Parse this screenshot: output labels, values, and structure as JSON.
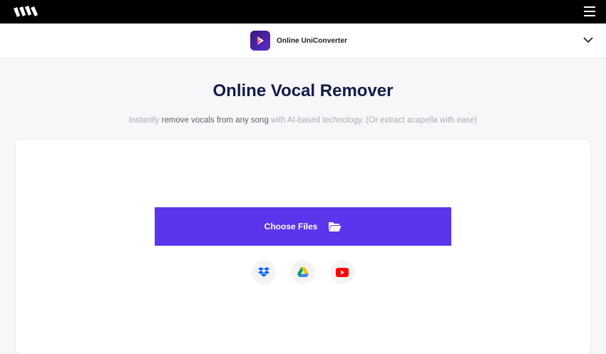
{
  "topbar": {
    "logo_icon": "wondershare-logo-icon",
    "menu_icon": "hamburger-menu-icon"
  },
  "subnav": {
    "product_name": "Online UniConverter",
    "product_icon": "uniconverter-app-icon",
    "expand_icon": "chevron-down-icon"
  },
  "hero": {
    "title": "Online Vocal Remover",
    "subtitle_part1": "Instantly ",
    "subtitle_highlight1": "remove vocals from any song",
    "subtitle_part2": " with AI-based technology. (Or extract acapella with ease)"
  },
  "upload": {
    "choose_label": "Choose Files",
    "choose_icon": "folder-open-icon",
    "sources": [
      {
        "name": "dropbox",
        "icon": "dropbox-icon"
      },
      {
        "name": "google-drive",
        "icon": "google-drive-icon"
      },
      {
        "name": "youtube",
        "icon": "youtube-icon"
      }
    ]
  },
  "colors": {
    "accent": "#5a35ec",
    "title": "#141c46",
    "topbar": "#000000",
    "subtitle": "#a9adb7",
    "background": "#f7f7f9"
  }
}
